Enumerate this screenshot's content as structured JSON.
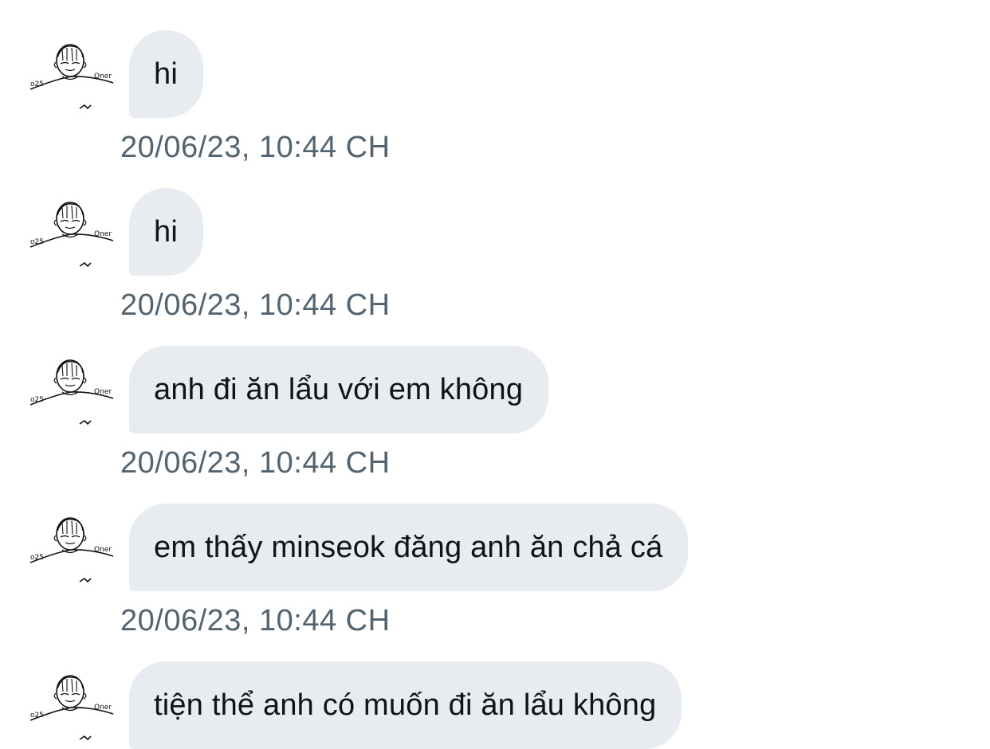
{
  "messages": [
    {
      "text": "hi",
      "timestamp": "20/06/23, 10:44 CH"
    },
    {
      "text": "hi",
      "timestamp": "20/06/23, 10:44 CH"
    },
    {
      "text": "anh đi ăn lẩu với em không",
      "timestamp": "20/06/23, 10:44 CH"
    },
    {
      "text": "em thấy minseok đăng anh ăn chả cá",
      "timestamp": "20/06/23, 10:44 CH"
    },
    {
      "text": "tiện thể anh có muốn đi ăn lẩu không",
      "timestamp": ""
    }
  ],
  "avatar": {
    "icon": "sketch-face-avatar-icon",
    "label_left": "o25",
    "label_right": "Oner"
  },
  "colors": {
    "bubble": "#e8ebef",
    "message_text": "#0f1419",
    "timestamp": "#536471",
    "background": "#ffffff"
  }
}
